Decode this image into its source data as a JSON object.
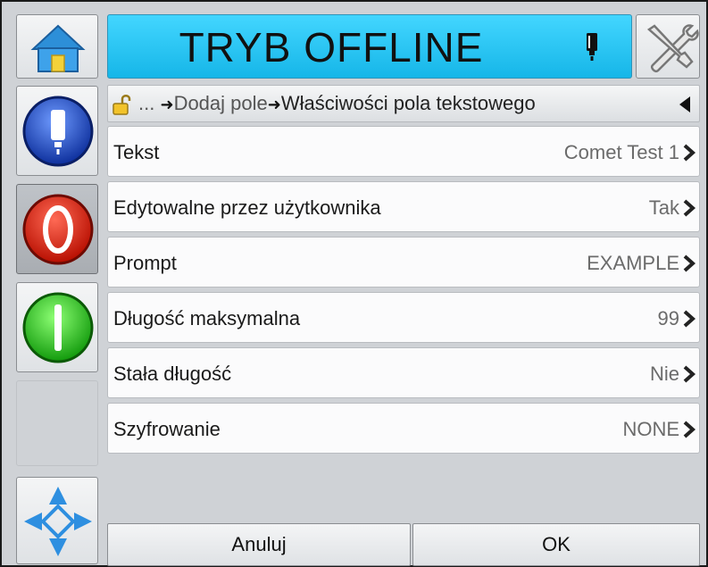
{
  "header": {
    "title": "TRYB OFFLINE"
  },
  "breadcrumb": {
    "ellipsis": "...",
    "items": [
      "Dodaj pole",
      "Właściwości pola tekstowego"
    ]
  },
  "fields": [
    {
      "label": "Tekst",
      "value": "Comet Test 1"
    },
    {
      "label": "Edytowalne przez użytkownika",
      "value": "Tak"
    },
    {
      "label": "Prompt",
      "value": "EXAMPLE"
    },
    {
      "label": "Długość maksymalna",
      "value": "99"
    },
    {
      "label": "Stała długość",
      "value": "Nie"
    },
    {
      "label": "Szyfrowanie",
      "value": "NONE"
    }
  ],
  "footer": {
    "cancel_label": "Anuluj",
    "ok_label": "OK"
  },
  "colors": {
    "title_bar": "#16b6e8",
    "stop_button": "#e0210f",
    "start_button": "#22c11c",
    "status_button": "#1b4fd1"
  },
  "icons": {
    "home": "home-icon",
    "tools": "wrench-screwdriver-icon",
    "ink": "ink-cartridge-icon",
    "lock": "unlocked-padlock-icon",
    "back": "triangle-left-icon",
    "nav": "navigation-arrows-icon"
  }
}
